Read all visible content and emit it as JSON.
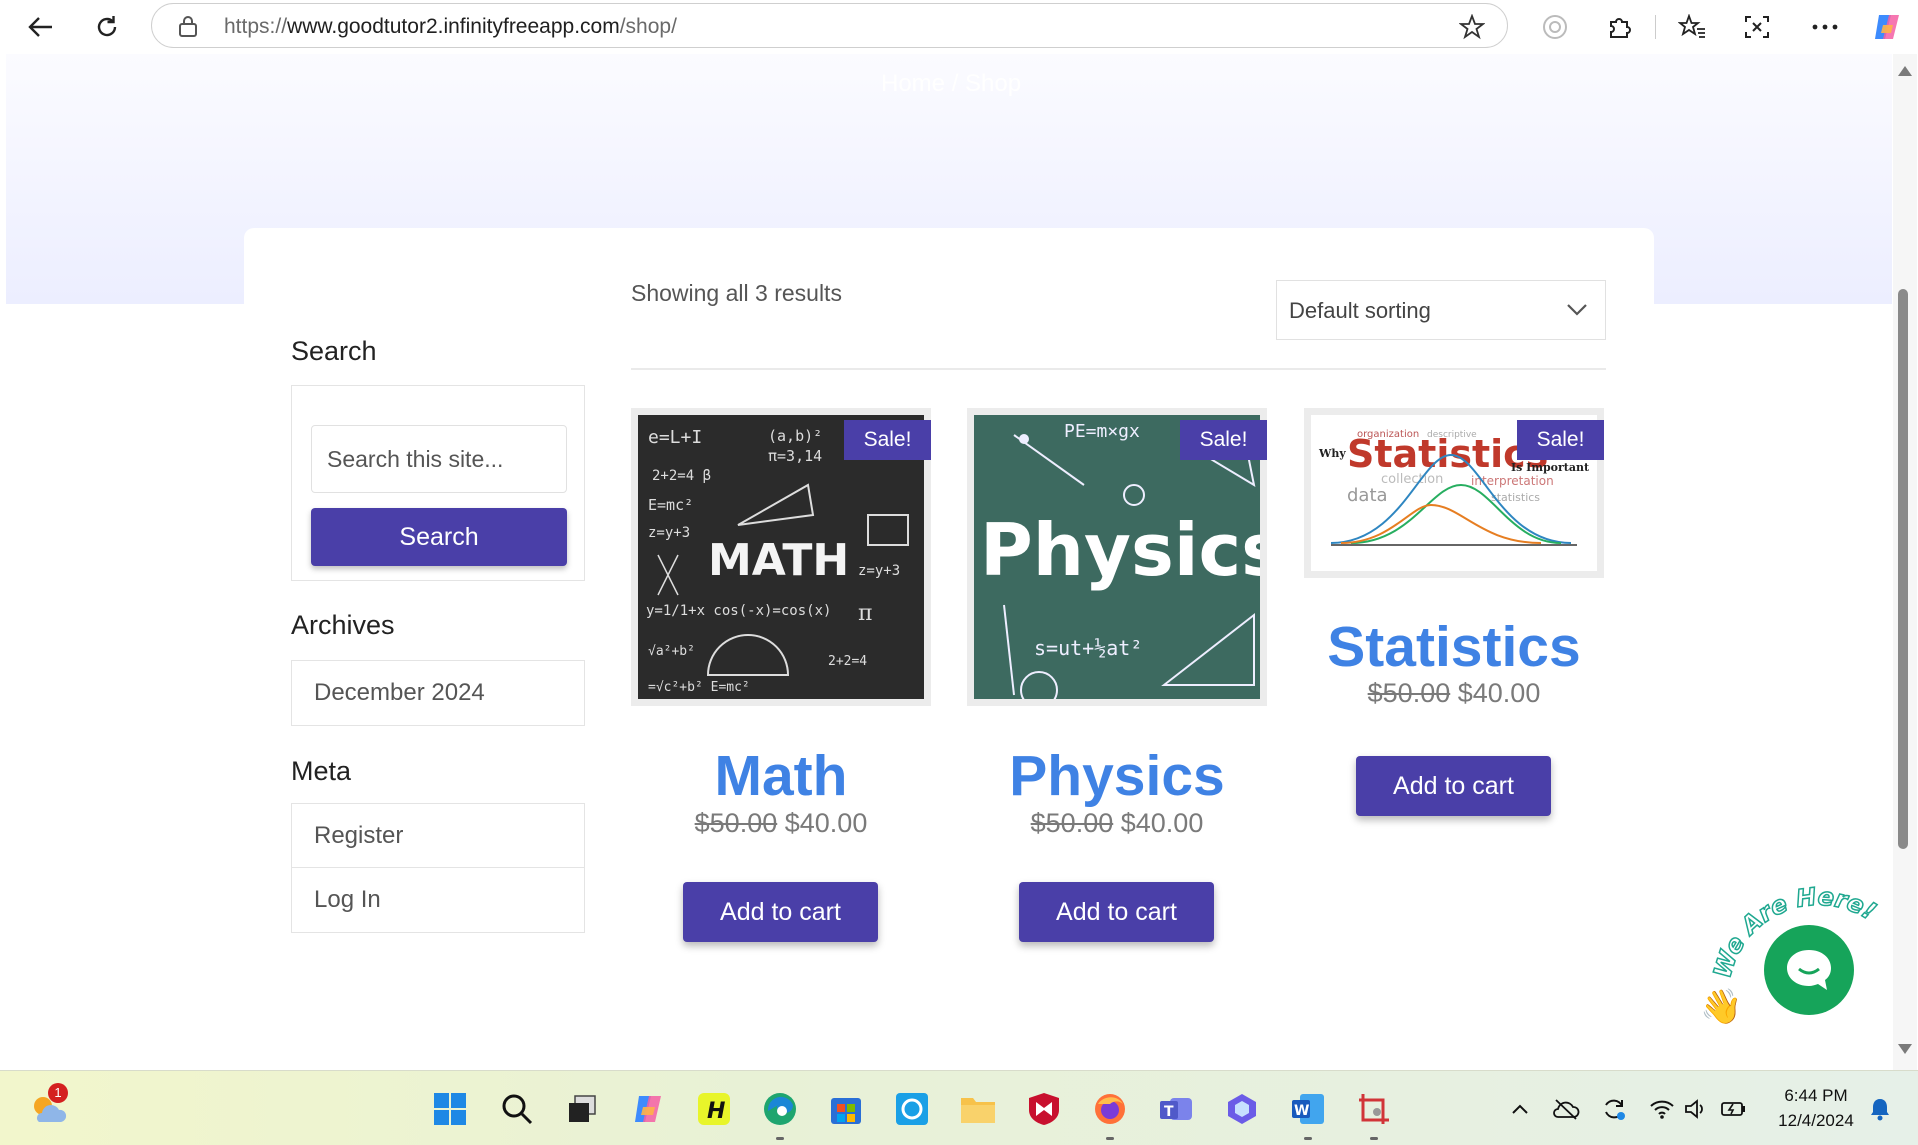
{
  "browser": {
    "url_prefix": "https://",
    "url_host": "www.goodtutor2.infinityfreeapp.com",
    "url_path": "/shop/"
  },
  "page": {
    "breadcrumb": "Home / Shop"
  },
  "sidebar": {
    "search_title": "Search",
    "search_placeholder": "Search this site...",
    "search_button": "Search",
    "archives_title": "Archives",
    "archives": [
      "December 2024"
    ],
    "meta_title": "Meta",
    "meta_links": [
      "Register",
      "Log In"
    ]
  },
  "shop": {
    "result_count": "Showing all 3 results",
    "sorting": "Default sorting",
    "products": [
      {
        "title": "Math",
        "sale_badge": "Sale!",
        "old_price": "$50.00",
        "new_price": "$40.00",
        "button": "Add to cart",
        "image_text": "MATH"
      },
      {
        "title": "Physics",
        "sale_badge": "Sale!",
        "old_price": "$50.00",
        "new_price": "$40.00",
        "button": "Add to cart",
        "image_text": "Physics"
      },
      {
        "title": "Statistics",
        "sale_badge": "Sale!",
        "old_price": "$50.00",
        "new_price": "$40.00",
        "button": "Add to cart",
        "image_text": "Statistics",
        "image_text_pre": "Why",
        "image_text_post": "Is Important",
        "image_words": [
          "organization",
          "descriptive",
          "collection",
          "interpretation",
          "data",
          "statistics"
        ]
      }
    ]
  },
  "chat": {
    "banner": "We Are Here!"
  },
  "taskbar": {
    "weather_badge": "1",
    "time": "6:44 PM",
    "date": "12/4/2024"
  },
  "colors": {
    "accent": "#4a3fa8",
    "title_blue": "#3f82e4",
    "chat_green": "#16a45a"
  }
}
